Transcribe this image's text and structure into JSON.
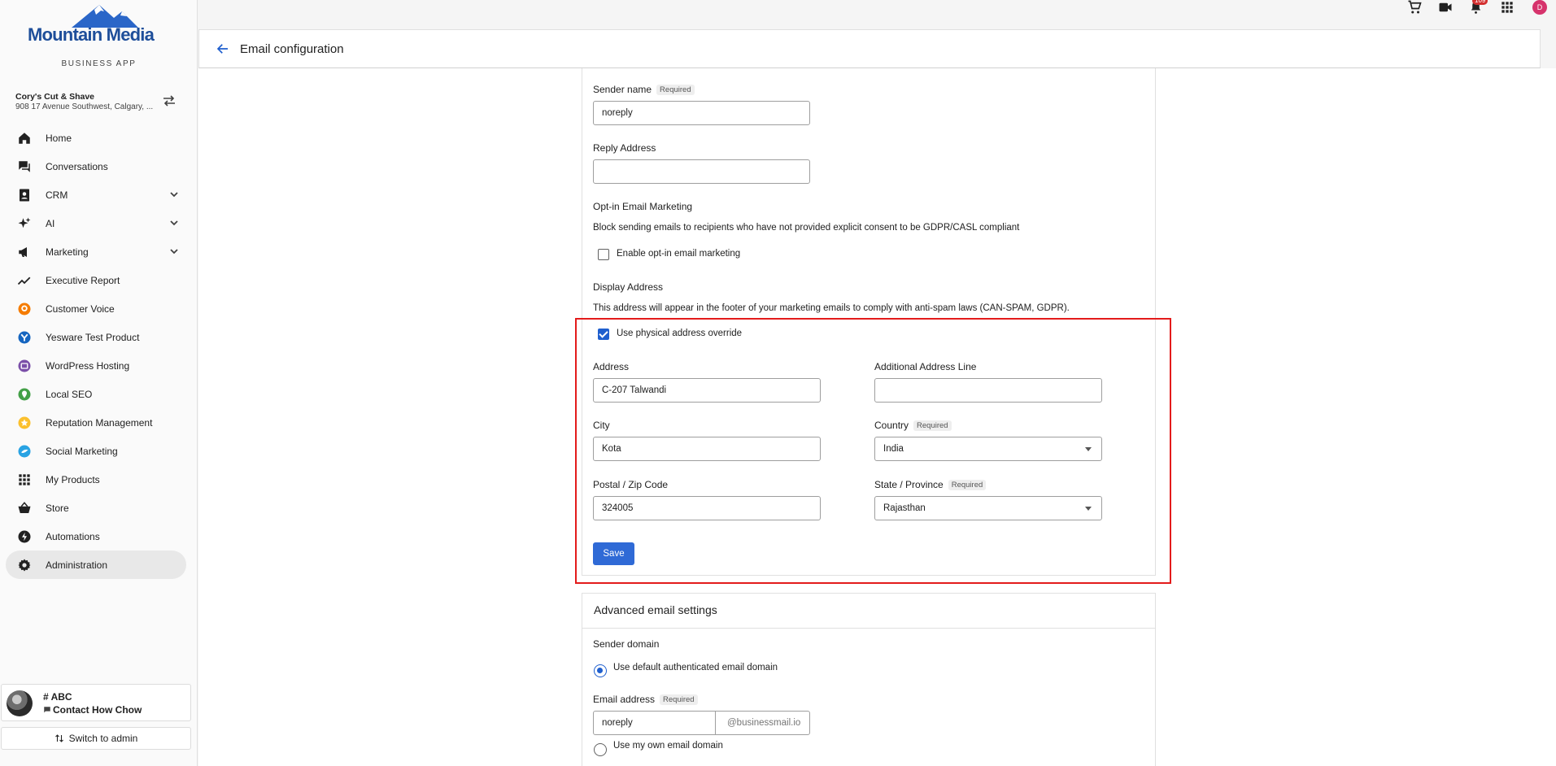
{
  "brand": {
    "name": "Mountain Media",
    "sub": "BUSINESS APP"
  },
  "business": {
    "name": "Cory's Cut & Shave",
    "address": "908 17 Avenue Southwest, Calgary, ..."
  },
  "nav": [
    {
      "label": "Home",
      "icon": "home-icon"
    },
    {
      "label": "Conversations",
      "icon": "chat-icon"
    },
    {
      "label": "CRM",
      "icon": "contacts-icon"
    },
    {
      "label": "AI",
      "icon": "sparkle-icon"
    },
    {
      "label": "Marketing",
      "icon": "megaphone-icon"
    },
    {
      "label": "Executive Report",
      "icon": "trend-icon"
    },
    {
      "label": "Customer Voice",
      "icon": "customer-voice-icon"
    },
    {
      "label": "Yesware Test Product",
      "icon": "yesware-icon"
    },
    {
      "label": "WordPress Hosting",
      "icon": "wordpress-icon"
    },
    {
      "label": "Local SEO",
      "icon": "location-icon"
    },
    {
      "label": "Reputation Management",
      "icon": "star-icon"
    },
    {
      "label": "Social Marketing",
      "icon": "social-icon"
    },
    {
      "label": "My Products",
      "icon": "grid-icon"
    },
    {
      "label": "Store",
      "icon": "basket-icon"
    },
    {
      "label": "Automations",
      "icon": "bolt-icon"
    },
    {
      "label": "Administration",
      "icon": "gear-icon"
    }
  ],
  "contact": {
    "title": "# ABC",
    "subtitle": "Contact How Chow"
  },
  "switch_admin": "Switch to admin",
  "topbar": {
    "notification_count": "109",
    "user_initial": "D"
  },
  "header": {
    "title": "Email configuration"
  },
  "form": {
    "sender_name_label": "Sender name",
    "required": "Required",
    "sender_name_value": "noreply",
    "reply_address_label": "Reply Address",
    "reply_address_value": "",
    "optin_title": "Opt-in Email Marketing",
    "optin_desc": "Block sending emails to recipients who have not provided explicit consent to be GDPR/CASL compliant",
    "optin_checkbox": "Enable opt-in email marketing",
    "display_title": "Display Address",
    "display_desc": "This address will appear in the footer of your marketing emails to comply with anti-spam laws (CAN-SPAM, GDPR).",
    "override_checkbox": "Use physical address override",
    "address_label": "Address",
    "address_value": "C-207 Talwandi",
    "additional_label": "Additional Address Line",
    "additional_value": "",
    "city_label": "City",
    "city_value": "Kota",
    "country_label": "Country",
    "country_value": "India",
    "postal_label": "Postal / Zip Code",
    "postal_value": "324005",
    "state_label": "State / Province",
    "state_value": "Rajasthan",
    "save": "Save"
  },
  "advanced": {
    "title": "Advanced email settings",
    "sender_domain_label": "Sender domain",
    "default_domain_option": "Use default authenticated email domain",
    "email_address_label": "Email address",
    "email_address_value": "noreply",
    "email_domain_suffix": "@businessmail.io",
    "own_domain_option": "Use my own email domain"
  },
  "colors": {
    "accent": "#1f5fce",
    "highlight": "#e31b1b",
    "brand": "#1e4e9a"
  }
}
